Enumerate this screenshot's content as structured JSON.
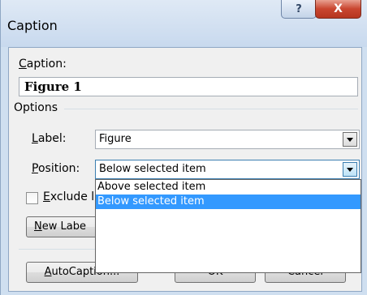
{
  "window": {
    "title": "Caption",
    "help_glyph": "?",
    "close_glyph": "X"
  },
  "caption": {
    "label": "Caption:",
    "value": "Figure 1"
  },
  "options": {
    "group_label": "Options",
    "label_field": {
      "label": "Label:",
      "value": "Figure"
    },
    "position_field": {
      "label": "Position:",
      "value": "Below selected item",
      "options": [
        "Above selected item",
        "Below selected item"
      ],
      "selected_index": 1
    },
    "exclude_label": "Exclude l"
  },
  "buttons": {
    "new_label": "New Labe",
    "autocaption": "AutoCaption...",
    "ok": "OK",
    "cancel": "Cancel"
  }
}
